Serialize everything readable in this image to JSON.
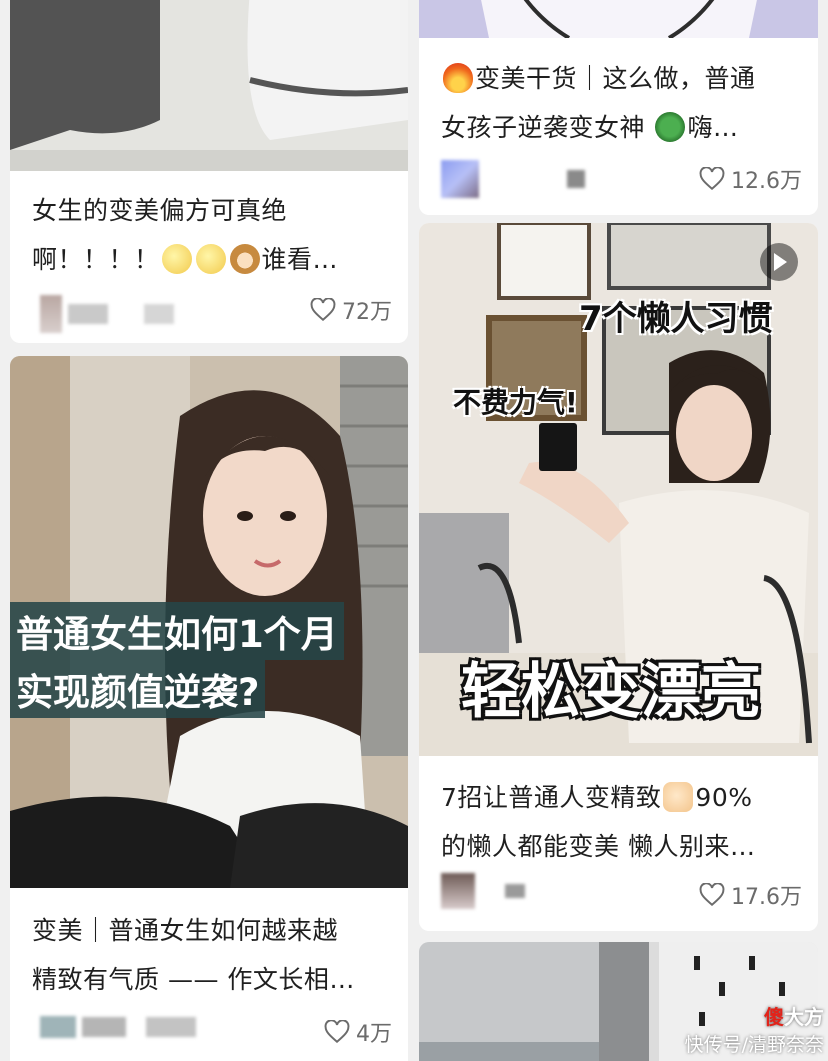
{
  "feed": {
    "cards": [
      {
        "title_lines": [
          "女生的变美偏方可真绝",
          "啊！！！！"
        ],
        "title_tail": "谁看…",
        "likes": "72万"
      },
      {
        "image_text": [
          "普通女生如何1个月",
          "实现颜值逆袭?"
        ],
        "title_lines": [
          "变美｜普通女生如何越来越",
          "精致有气质 —— 作文长相…"
        ],
        "likes": "4万"
      },
      {
        "title_lead": "变美干货｜这么做，普通",
        "title_line2": "女孩子逆袭变女神",
        "title_tail": "嗨…",
        "likes": "12.6万"
      },
      {
        "image_text": [
          "7个懒人习惯",
          "不费力气!",
          "轻松变漂亮"
        ],
        "title_line1": "7招让普通人变精致",
        "title_line1_tail": "90%",
        "title_line2": "的懒人都能变美 懒人别来…",
        "likes": "17.6万"
      }
    ]
  },
  "watermark": {
    "brand_red": "傻",
    "brand_rest": "大方",
    "source": "快传号/清野奈奈"
  },
  "colors": {
    "accent_text": "#1f1f1f",
    "muted": "#6b6b6b",
    "watermark_red": "#e2231a"
  }
}
